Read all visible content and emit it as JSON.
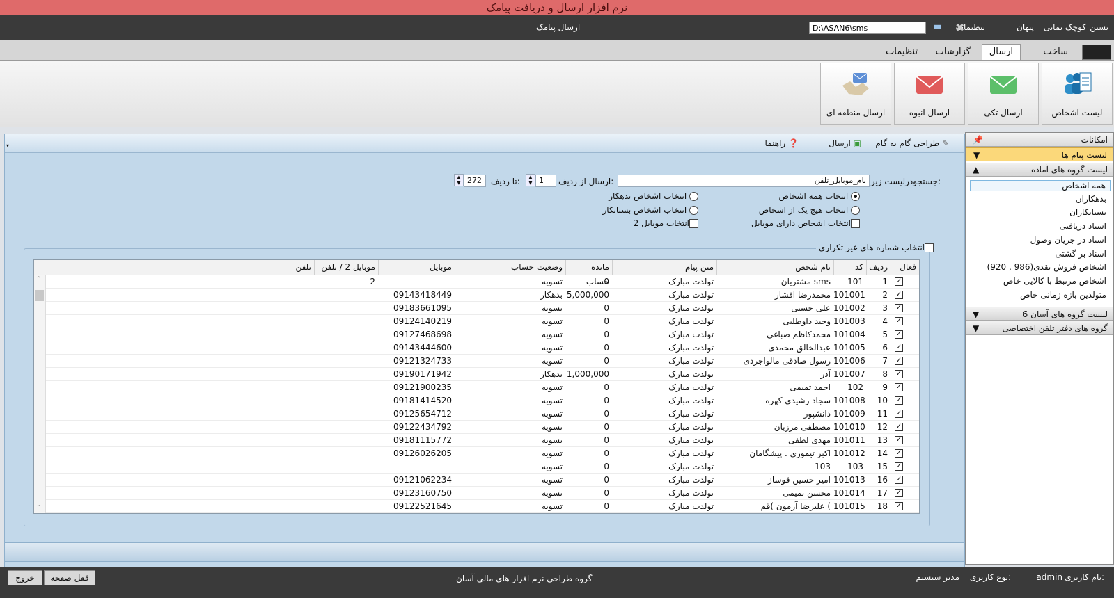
{
  "app_title": "نرم افزار ارسال و دریافت پیامک",
  "top_menu": {
    "close": "بستن",
    "minimize": "کوچک نمایی",
    "hide": "پنهان",
    "settings": "تنظیمات",
    "path": "D:\\ASAN6\\sms",
    "window_title": "ارسال پیامک"
  },
  "tabs": [
    "ساخت",
    "ارسال",
    "گزارشات",
    "تنظیمات"
  ],
  "ribbon": {
    "person_list": "لیست اشخاص",
    "single_send": "ارسال تکی",
    "bulk_send": "ارسال انبوه",
    "regional_send": "ارسال منطقه ای"
  },
  "toolbar": {
    "wizard": "طراحی گام به گام",
    "send": "ارسال",
    "help": "راهنما"
  },
  "form": {
    "search_label": "جستجودرلیست زیر:",
    "search_value": "نام_موبایل_تلفن",
    "from_label": "ارسال از ردیف:",
    "from_value": "1",
    "to_label": "تا ردیف:",
    "to_value": "272",
    "select_all": "انتخاب همه اشخاص",
    "select_debtors": "انتخاب اشخاص بدهکار",
    "select_none": "انتخاب هیچ یک از اشخاص",
    "select_creditors": "انتخاب اشخاص بستانکار",
    "select_with_mobile": "انتخاب اشخاص دارای موبایل",
    "select_mobile2": "انتخاب موبایل 2",
    "unique_numbers": "انتخاب شماره های غیر تکراری"
  },
  "grid": {
    "headers": {
      "active": "فعال",
      "row": "ردیف",
      "code": "کد",
      "name": "نام شخص",
      "message": "متن پیام",
      "balance": "مانده حساب",
      "status": "وضعیت حساب",
      "mobile": "موبایل",
      "mobile2": "موبایل 2 / تلفن 2",
      "phone": "تلفن"
    },
    "rows": [
      {
        "row": "1",
        "code": "101",
        "name": "مشتریان sms",
        "msg": "تولدت مبارک",
        "bal": "0",
        "status": "تسویه",
        "mobile": ""
      },
      {
        "row": "2",
        "code": "101001",
        "name": "محمدرضا افشار",
        "msg": "تولدت مبارک",
        "bal": "5,000,000",
        "status": "بدهکار",
        "mobile": "09143418449"
      },
      {
        "row": "3",
        "code": "101002",
        "name": "علی حسنی",
        "msg": "تولدت مبارک",
        "bal": "0",
        "status": "تسویه",
        "mobile": "09183661095"
      },
      {
        "row": "4",
        "code": "101003",
        "name": "وحید داوطلبی",
        "msg": "تولدت مبارک",
        "bal": "0",
        "status": "تسویه",
        "mobile": "09124140219"
      },
      {
        "row": "5",
        "code": "101004",
        "name": "محمدکاظم صباغی",
        "msg": "تولدت مبارک",
        "bal": "0",
        "status": "تسویه",
        "mobile": "09127468698"
      },
      {
        "row": "6",
        "code": "101005",
        "name": "عبدالخالق محمدی",
        "msg": "تولدت مبارک",
        "bal": "0",
        "status": "تسویه",
        "mobile": "09143444600"
      },
      {
        "row": "7",
        "code": "101006",
        "name": "رسول صادقی مالواجردی",
        "msg": "تولدت مبارک",
        "bal": "0",
        "status": "تسویه",
        "mobile": "09121324733"
      },
      {
        "row": "8",
        "code": "101007",
        "name": "آذر",
        "msg": "تولدت مبارک",
        "bal": "1,000,000",
        "status": "بدهکار",
        "mobile": "09190171942"
      },
      {
        "row": "9",
        "code": "102",
        "name": "احمد تمیمی",
        "msg": "تولدت مبارک",
        "bal": "0",
        "status": "تسویه",
        "mobile": "09121900235"
      },
      {
        "row": "10",
        "code": "101008",
        "name": "سجاد رشیدی کهره",
        "msg": "تولدت مبارک",
        "bal": "0",
        "status": "تسویه",
        "mobile": "09181414520"
      },
      {
        "row": "11",
        "code": "101009",
        "name": "دانشپور",
        "msg": "تولدت مبارک",
        "bal": "0",
        "status": "تسویه",
        "mobile": "09125654712"
      },
      {
        "row": "12",
        "code": "101010",
        "name": "مصطفی مرزبان",
        "msg": "تولدت مبارک",
        "bal": "0",
        "status": "تسویه",
        "mobile": "09122434792"
      },
      {
        "row": "13",
        "code": "101011",
        "name": "مهدی لطفی",
        "msg": "تولدت مبارک",
        "bal": "0",
        "status": "تسویه",
        "mobile": "09181115772"
      },
      {
        "row": "14",
        "code": "101012",
        "name": "اکبر تیموری . پیشگامان",
        "msg": "تولدت مبارک",
        "bal": "0",
        "status": "تسویه",
        "mobile": "09126026205"
      },
      {
        "row": "15",
        "code": "103",
        "name": "103",
        "msg": "تولدت مبارک",
        "bal": "0",
        "status": "تسویه",
        "mobile": ""
      },
      {
        "row": "16",
        "code": "101013",
        "name": "امیر حسین قوساز",
        "msg": "تولدت مبارک",
        "bal": "0",
        "status": "تسویه",
        "mobile": "09121062234"
      },
      {
        "row": "17",
        "code": "101014",
        "name": "محسن تمیمی",
        "msg": "تولدت مبارک",
        "bal": "0",
        "status": "تسویه",
        "mobile": "09123160750"
      },
      {
        "row": "18",
        "code": "101015",
        "name": "علیرضا آزمون )قم (",
        "msg": "تولدت مبارک",
        "bal": "0",
        "status": "تسویه",
        "mobile": "09122521645"
      }
    ]
  },
  "sidebar": {
    "title": "امکانات",
    "message_list": "لیست پیام ها",
    "ready_groups": "لیست گروه های آماده",
    "groups": [
      "همه اشخاص",
      "بدهکاران",
      "بستانکاران",
      "اسناد دریافتی",
      "اسناد در جریان وصول",
      "اسناد بر گشتی",
      "اشخاص فروش نقدی(986 , 920)",
      "اشخاص مرتبط با کالایی خاص",
      "متولدین بازه زمانی خاص"
    ],
    "asan_groups": "لیست گروه های آسان 6",
    "phonebook_groups": "گروه های دفتر تلفن اختصاصی"
  },
  "status": {
    "user_name_label": "نام کاربری:",
    "user_name": "admin",
    "user_type_label": "نوع کاربری:",
    "user_type": "مدیر سیستم",
    "company": "گروه طراحی نرم افزار های مالی آسان",
    "lock": "قفل صفحه",
    "exit": "خروج"
  },
  "colors": {
    "title_bar": "#df6a6a",
    "dark_bar": "#3a3a3a",
    "panel": "#c2d8ea",
    "selected_group": "#fbd87a"
  }
}
